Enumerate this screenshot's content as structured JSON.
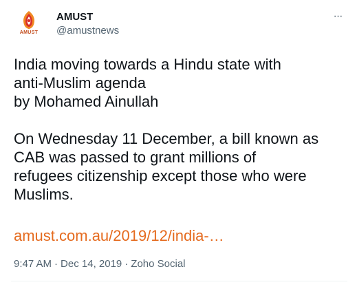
{
  "tweet": {
    "display_name": "AMUST",
    "handle": "@amustnews",
    "avatar_label": "AMUST",
    "more_label": "···",
    "body": "India moving towards a Hindu state with\nanti-Muslim agenda\nby Mohamed Ainullah\n\nOn Wednesday 11 December, a bill known as\nCAB was passed to grant millions of\nrefugees citizenship except those who were\nMuslims.",
    "link_text": "amust.com.au/2019/12/india-…",
    "time": "9:47 AM",
    "date": "Dec 14, 2019",
    "source": "Zoho Social",
    "separator": "·"
  },
  "colors": {
    "link": "#e56b1f",
    "text": "#0f1419",
    "secondary": "#536471",
    "logo_red": "#d9302b",
    "logo_orange": "#f08a24"
  }
}
